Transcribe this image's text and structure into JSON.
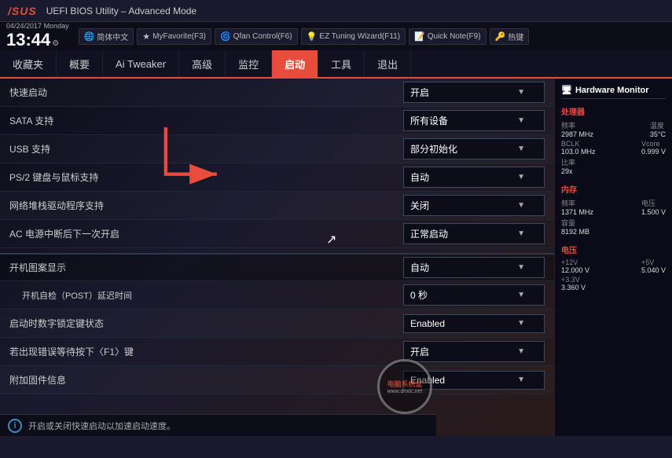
{
  "titlebar": {
    "logo": "/SUS",
    "title": "UEFI BIOS Utility – Advanced Mode"
  },
  "topbar": {
    "date": "04/24/2017",
    "day": "Monday",
    "time": "13:44",
    "buttons": [
      {
        "icon": "🌐",
        "label": "简体中文"
      },
      {
        "icon": "★",
        "label": "MyFavorite(F3)"
      },
      {
        "icon": "🌀",
        "label": "Qfan Control(F6)"
      },
      {
        "icon": "💡",
        "label": "EZ Tuning Wizard(F11)"
      },
      {
        "icon": "📝",
        "label": "Quick Note(F9)"
      },
      {
        "icon": "🔑",
        "label": "热键"
      }
    ]
  },
  "navbar": {
    "items": [
      {
        "label": "收藏夹",
        "active": false
      },
      {
        "label": "概要",
        "active": false
      },
      {
        "label": "Ai Tweaker",
        "active": false
      },
      {
        "label": "高级",
        "active": false
      },
      {
        "label": "监控",
        "active": false
      },
      {
        "label": "启动",
        "active": true
      },
      {
        "label": "工具",
        "active": false
      },
      {
        "label": "退出",
        "active": false
      }
    ]
  },
  "settings": [
    {
      "label": "快速启动",
      "value": "开启",
      "indent": false,
      "group": false
    },
    {
      "label": "SATA 支持",
      "value": "所有设备",
      "indent": false,
      "group": false
    },
    {
      "label": "USB 支持",
      "value": "部分初始化",
      "indent": false,
      "group": false
    },
    {
      "label": "PS/2 键盘与鼠标支持",
      "value": "自动",
      "indent": false,
      "group": false
    },
    {
      "label": "网络堆栈驱动程序支持",
      "value": "关闭",
      "indent": false,
      "group": false
    },
    {
      "label": "AC 电源中断后下一次开启",
      "value": "正常启动",
      "indent": false,
      "group": false
    },
    {
      "label": "开机图案显示",
      "value": "自动",
      "indent": false,
      "group": true
    },
    {
      "label": "开机自检（POST）延迟时间",
      "value": "0 秒",
      "indent": true,
      "group": false
    },
    {
      "label": "启动时数字锁定键状态",
      "value": "Enabled",
      "indent": false,
      "group": false
    },
    {
      "label": "若出现错误等待按下〈F1〉键",
      "value": "开启",
      "indent": false,
      "group": false
    },
    {
      "label": "附加固件信息",
      "value": "Enabled",
      "indent": false,
      "group": false
    }
  ],
  "statusbar": {
    "text": "开启或关闭快速启动以加速启动速度。"
  },
  "sidebar": {
    "title": "Hardware Monitor",
    "sections": [
      {
        "name": "处理器",
        "rows": [
          {
            "left_label": "频率",
            "right_label": "温度",
            "left_value": "2987 MHz",
            "right_value": "35°C"
          },
          {
            "left_label": "BCLK",
            "right_label": "Vcore",
            "left_value": "103.0 MHz",
            "right_value": "0.999 V"
          },
          {
            "left_label": "比率",
            "right_label": "",
            "left_value": "29x",
            "right_value": ""
          }
        ]
      },
      {
        "name": "内存",
        "rows": [
          {
            "left_label": "频率",
            "right_label": "电压",
            "left_value": "1371 MHz",
            "right_value": "1.500 V"
          },
          {
            "left_label": "容量",
            "right_label": "",
            "left_value": "8192 MB",
            "right_value": ""
          }
        ]
      },
      {
        "name": "电压",
        "rows": [
          {
            "left_label": "+12V",
            "right_label": "+5V",
            "left_value": "12.000 V",
            "right_value": "5.040 V"
          },
          {
            "left_label": "+3.3V",
            "right_label": "",
            "left_value": "3.360 V",
            "right_value": ""
          }
        ]
      }
    ]
  },
  "watermark": {
    "line1": "电脑系统盒",
    "line2": "www.dnxic.net"
  }
}
